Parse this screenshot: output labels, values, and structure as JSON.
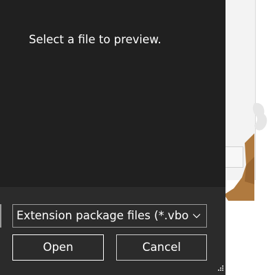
{
  "dialog": {
    "preview_message": "Select a file to preview.",
    "file_type_filter": {
      "selected": "Extension package files (*.vbox-"
    },
    "open_label": "Open",
    "cancel_label": "Cancel"
  },
  "colors": {
    "dialog_background": "#202020",
    "footer_background": "#2b2b2b",
    "text": "#ffffff",
    "border": "#9a9a9a"
  },
  "icons": {
    "filter_dropdown": "chevron-down-icon",
    "resize": "resize-grip-icon"
  }
}
